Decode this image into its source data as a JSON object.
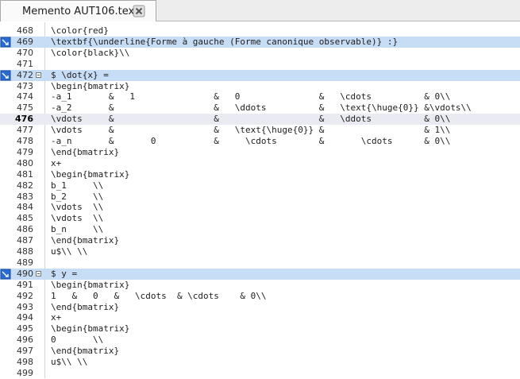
{
  "tab": {
    "filename": "Memento AUT106.tex",
    "close_icon": "close-x-icon"
  },
  "lines": [
    {
      "n": "468",
      "t": "\\color{red}"
    },
    {
      "n": "469",
      "t": "\\textbf{\\underline{Forme à gauche (Forme canonique observable)} :}",
      "hl": true,
      "bm": true
    },
    {
      "n": "470",
      "t": "\\color{black}\\\\"
    },
    {
      "n": "471",
      "t": ""
    },
    {
      "n": "472",
      "t": "$ \\dot{x} =",
      "hl": true,
      "bm": true,
      "fold": true
    },
    {
      "n": "473",
      "t": "\\begin{bmatrix}"
    },
    {
      "n": "474",
      "t": "-a_1       &   1               &   0               &   \\cdots          & 0\\\\"
    },
    {
      "n": "475",
      "t": "-a_2       &                   &   \\ddots          &   \\text{\\huge{0}} &\\vdots\\\\"
    },
    {
      "n": "476",
      "t": "\\vdots     &                   &                   &   \\ddots          & 0\\\\",
      "cur": true
    },
    {
      "n": "477",
      "t": "\\vdots     &                   &   \\text{\\huge{0}} &                   & 1\\\\"
    },
    {
      "n": "478",
      "t": "-a_n       &       0           &     \\cdots        &       \\cdots      & 0\\\\"
    },
    {
      "n": "479",
      "t": "\\end{bmatrix}"
    },
    {
      "n": "480",
      "t": "x+"
    },
    {
      "n": "481",
      "t": "\\begin{bmatrix}"
    },
    {
      "n": "482",
      "t": "b_1     \\\\"
    },
    {
      "n": "483",
      "t": "b_2     \\\\"
    },
    {
      "n": "484",
      "t": "\\vdots  \\\\"
    },
    {
      "n": "485",
      "t": "\\vdots  \\\\"
    },
    {
      "n": "486",
      "t": "b_n     \\\\"
    },
    {
      "n": "487",
      "t": "\\end{bmatrix}"
    },
    {
      "n": "488",
      "t": "u$\\\\ \\\\"
    },
    {
      "n": "489",
      "t": ""
    },
    {
      "n": "490",
      "t": "$ y =",
      "hl": true,
      "bm": true,
      "fold": true
    },
    {
      "n": "491",
      "t": "\\begin{bmatrix}"
    },
    {
      "n": "492",
      "t": "1   &   0   &   \\cdots  & \\cdots    & 0\\\\"
    },
    {
      "n": "493",
      "t": "\\end{bmatrix}"
    },
    {
      "n": "494",
      "t": "x+"
    },
    {
      "n": "495",
      "t": "\\begin{bmatrix}"
    },
    {
      "n": "496",
      "t": "0       \\\\"
    },
    {
      "n": "497",
      "t": "\\end{bmatrix}"
    },
    {
      "n": "498",
      "t": "u$\\\\ \\\\"
    },
    {
      "n": "499",
      "t": ""
    }
  ],
  "colors": {
    "highlight": "#c7dcf5",
    "current_line": "#eaeaf3",
    "bookmark": "#2a6bd1"
  }
}
